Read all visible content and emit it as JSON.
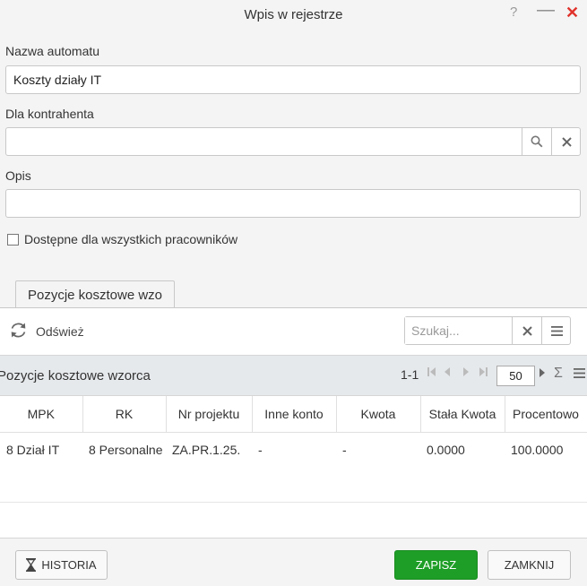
{
  "window": {
    "title": "Wpis w rejestrze",
    "help": "?",
    "minimize": "—",
    "close": "✕"
  },
  "form": {
    "name_label": "Nazwa automatu",
    "name_value": "Koszty działy IT",
    "contractor_label": "Dla kontrahenta",
    "contractor_value": "",
    "description_label": "Opis",
    "description_value": "",
    "available_label": "Dostępne dla wszystkich pracowników",
    "available_checked": false
  },
  "tabs": [
    {
      "label": "Pozycje kosztowe wzo",
      "active": true
    }
  ],
  "toolbar": {
    "refresh_label": "Odśwież",
    "search_placeholder": "Szukaj..."
  },
  "grid": {
    "title": "Pozycje kosztowe wzorca",
    "range": "1-1",
    "page_size": "50",
    "columns": [
      "MPK",
      "RK",
      "Nr projektu",
      "Inne konto",
      "Kwota",
      "Stała Kwota",
      "Procentowo"
    ],
    "rows": [
      [
        "8 Dział IT",
        "8 Personalne",
        "ZA.PR.1.25.",
        "-",
        "-",
        "0.0000",
        "100.0000"
      ]
    ]
  },
  "footer": {
    "history_label": "HISTORIA",
    "save_label": "ZAPISZ",
    "close_label": "ZAMKNIJ"
  },
  "colors": {
    "accent_green": "#1e9e26",
    "close_red": "#e0322b"
  },
  "icons": [
    "help-icon",
    "minimize-icon",
    "close-icon",
    "search-icon",
    "clear-icon",
    "refresh-icon",
    "menu-icon",
    "first-page-icon",
    "prev-page-icon",
    "next-page-icon",
    "last-page-icon",
    "sigma-icon",
    "hourglass-icon"
  ]
}
